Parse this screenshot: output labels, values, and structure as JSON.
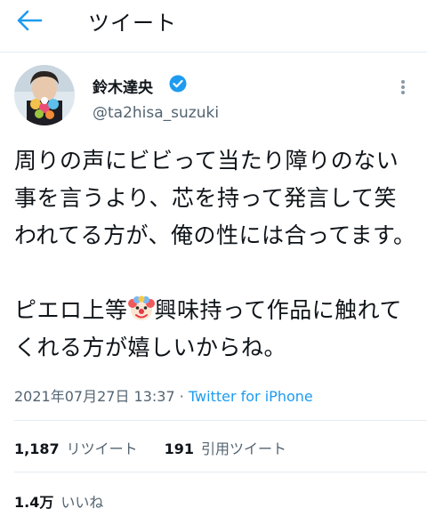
{
  "header": {
    "title": "ツイート"
  },
  "author": {
    "name": "鈴木達央",
    "handle": "@ta2hisa_suzuki",
    "verified": true
  },
  "tweet": {
    "text_part1": "周りの声にビビって当たり障りのない事を言うより、芯を持って発言して笑われてる方が、俺の性には合ってます。\n\nピエロ上等",
    "emoji": "clown-face-icon",
    "text_part2": "興味持って作品に触れてくれる方が嬉しいからね。"
  },
  "meta": {
    "timestamp": "2021年07月27日 13:37",
    "separator": "·",
    "source": "Twitter for iPhone"
  },
  "stats": {
    "retweets_count": "1,187",
    "retweets_label": "リツイート",
    "quotes_count": "191",
    "quotes_label": "引用ツイート",
    "likes_count": "1.4万",
    "likes_label": "いいね"
  },
  "colors": {
    "accent": "#1d9bf0",
    "secondary_text": "#536471",
    "divider": "#e6ecf0"
  }
}
